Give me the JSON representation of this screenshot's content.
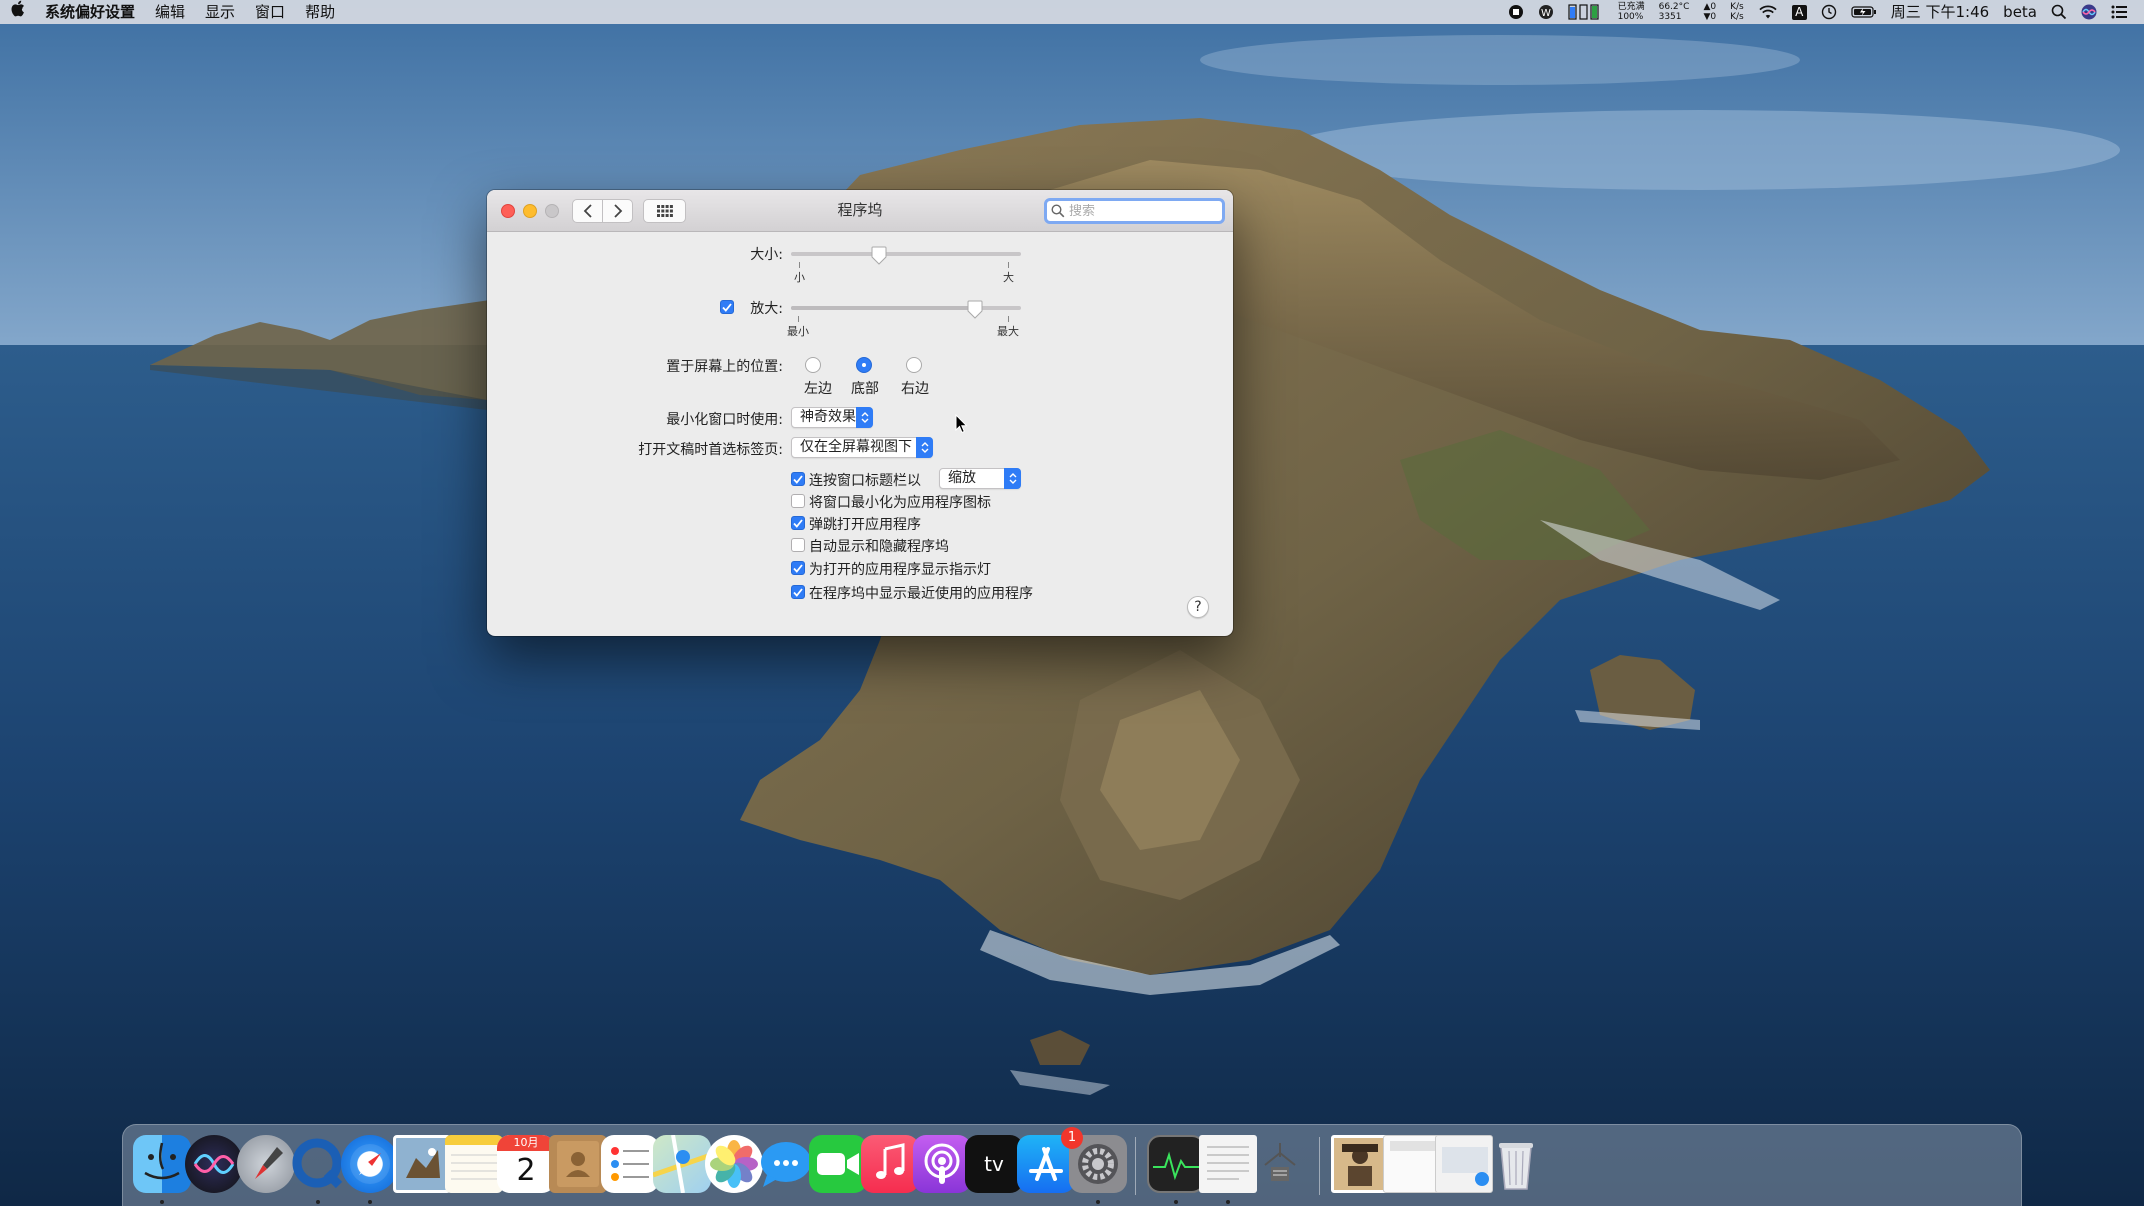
{
  "menubar": {
    "apple": "",
    "app_name": "系统偏好设置",
    "menus": [
      "编辑",
      "显示",
      "窗口",
      "帮助"
    ],
    "battery_status": [
      "已充满",
      "100%"
    ],
    "cpu_stats": [
      "66.2°C",
      "3351"
    ],
    "fan_stats": [
      "0",
      "0"
    ],
    "net_stats": [
      "K/s",
      "K/s"
    ],
    "input_method": "A",
    "clock": "周三 下午1:46",
    "user": "beta"
  },
  "window": {
    "title": "程序坞",
    "search_placeholder": "搜索",
    "size": {
      "label": "大小:",
      "min_label": "小",
      "max_label": "大",
      "value": 0.4
    },
    "magnification": {
      "label": "放大:",
      "checked": true,
      "min_label": "最小",
      "max_label": "最大",
      "value": 0.83
    },
    "position": {
      "label": "置于屏幕上的位置:",
      "options": [
        "左边",
        "底部",
        "右边"
      ],
      "selected": "底部"
    },
    "minimize_effect": {
      "label": "最小化窗口时使用:",
      "value": "神奇效果"
    },
    "prefer_tabs": {
      "label": "打开文稿时首选标签页:",
      "value": "仅在全屏幕视图下"
    },
    "double_click": {
      "label": "连按窗口标题栏以",
      "checked": true,
      "value": "缩放"
    },
    "checkboxes": [
      {
        "label": "将窗口最小化为应用程序图标",
        "checked": false
      },
      {
        "label": "弹跳打开应用程序",
        "checked": true
      },
      {
        "label": "自动显示和隐藏程序坞",
        "checked": false
      },
      {
        "label": "为打开的应用程序显示指示灯",
        "checked": true
      },
      {
        "label": "在程序坞中显示最近使用的应用程序",
        "checked": true
      }
    ],
    "help": "?"
  },
  "dock": {
    "calendar_month": "10月",
    "calendar_day": "2",
    "appstore_badge": "1",
    "tv_label": "tv"
  },
  "colors": {
    "accent": "#2f7cf6",
    "close": "#fe5f57",
    "minimize": "#febc2e"
  }
}
